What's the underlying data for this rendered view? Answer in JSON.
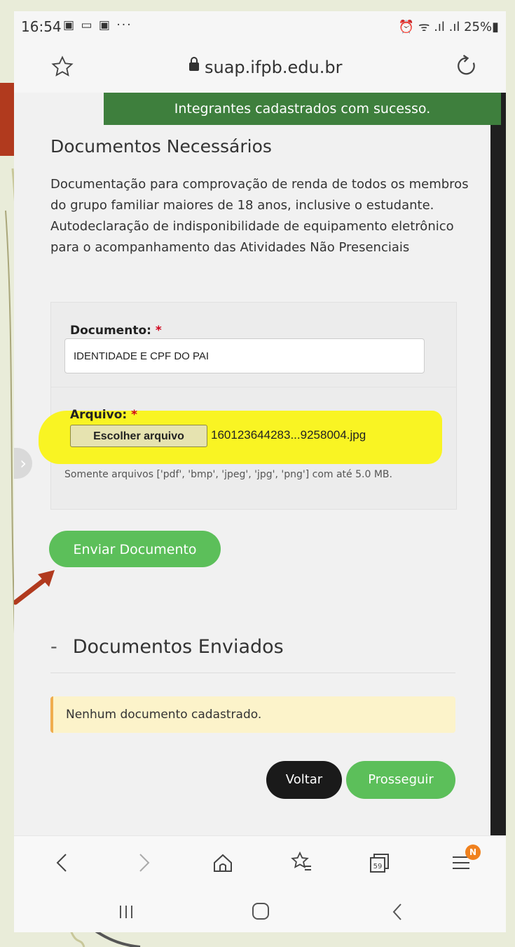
{
  "status_bar": {
    "time": "16:54",
    "notifications": "▣ ▭ ▣ ···",
    "right": "⏰ ᯤ .ıl .ıl 25%▮"
  },
  "browser": {
    "url": "suap.ifpb.edu.br",
    "star_icon": "star-outline-icon",
    "reload_icon": "reload-icon"
  },
  "page": {
    "success_message": "Integrantes cadastrados com sucesso.",
    "section_title": "Documentos Necessários",
    "description": [
      "Documentação para comprovação de renda de todos os membros do grupo familiar maiores de 18 anos, inclusive o estudante.",
      "Autodeclaração de indisponibilidade de equipamento eletrônico para o acompanhamento das Atividades Não Presenciais"
    ],
    "form": {
      "document_label": "Documento:",
      "required_mark": "*",
      "document_value": "IDENTIDADE E CPF DO PAI",
      "file_label": "Arquivo:",
      "choose_file_button": "Escolher arquivo",
      "file_name": "160123644283...9258004.jpg",
      "help_text": "Somente arquivos ['pdf', 'bmp', 'jpeg', 'jpg', 'png'] com até 5.0 MB."
    },
    "send_button": "Enviar Documento",
    "sent_section": {
      "toggle": "-",
      "title": "Documentos Enviados"
    },
    "empty_alert": "Nenhum documento cadastrado.",
    "back_button": "Voltar",
    "next_button": "Prosseguir",
    "side_tab": "›"
  },
  "bottom_nav": {
    "badge": "N",
    "tabs_count": "59"
  },
  "colors": {
    "success_bg": "#3e7f3d",
    "green_button": "#5cbf5a",
    "highlight": "#f9f423",
    "annotation_arrow": "#b13a1e"
  }
}
